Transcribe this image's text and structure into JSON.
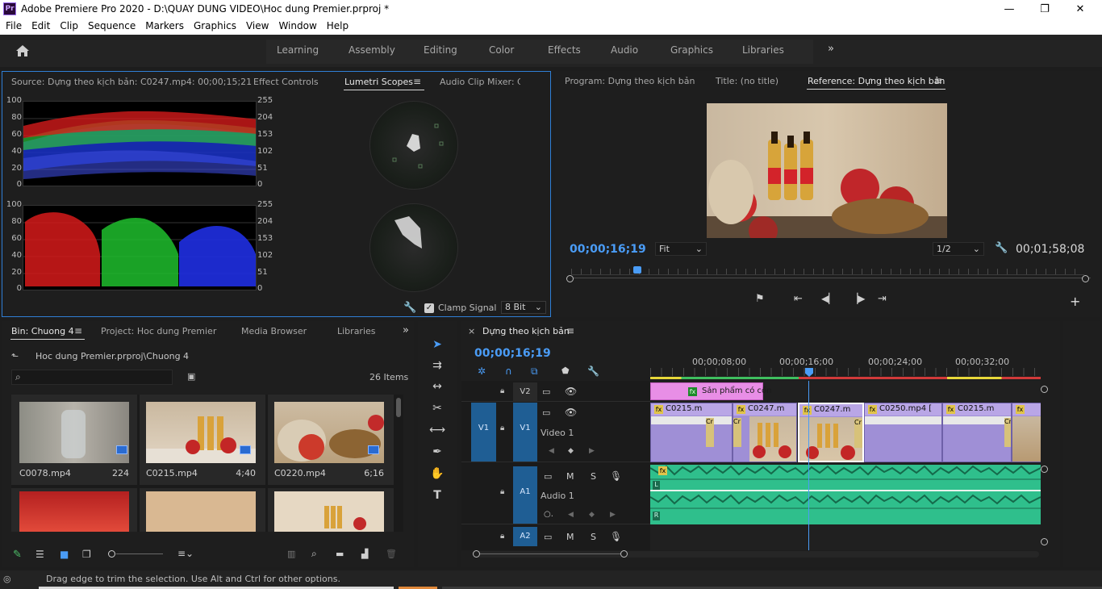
{
  "titlebar": {
    "app_title": "Adobe Premiere Pro 2020 - D:\\QUAY DUNG VIDEO\\Hoc dung Premier.prproj *",
    "logo": "Pr",
    "minimize": "—",
    "restore": "❐",
    "close": "✕"
  },
  "menu": [
    "File",
    "Edit",
    "Clip",
    "Sequence",
    "Markers",
    "Graphics",
    "View",
    "Window",
    "Help"
  ],
  "workspaces": [
    "Learning",
    "Assembly",
    "Editing",
    "Color",
    "Effects",
    "Audio",
    "Graphics",
    "Libraries"
  ],
  "source_panel": {
    "tabs": [
      "Source: Dựng theo kịch bản: C0247.mp4: 00;00;15;21",
      "Effect Controls",
      "Lumetri Scopes",
      "Audio Clip Mixer: C("
    ],
    "scale_left": [
      "100",
      "80",
      "60",
      "40",
      "20",
      "0"
    ],
    "scale_right": [
      "255",
      "204",
      "153",
      "102",
      "51",
      "0"
    ],
    "clamp_label": "Clamp Signal",
    "bit_depth": "8 Bit"
  },
  "program_panel": {
    "tabs": [
      "Program: Dựng theo kịch bản",
      "Title: (no title)",
      "Reference: Dựng theo kịch bản"
    ],
    "timecode": "00;00;16;19",
    "fit": "Fit",
    "resolution": "1/2",
    "duration": "00;01;58;08"
  },
  "project_panel": {
    "tabs": [
      "Bin: Chuong 4",
      "Project: Hoc dung Premier",
      "Media Browser",
      "Libraries"
    ],
    "path": "Hoc dung Premier.prproj\\Chuong 4",
    "items_count": "26 Items",
    "items": [
      {
        "name": "C0078.mp4",
        "duration": "224"
      },
      {
        "name": "C0215.mp4",
        "duration": "4;40"
      },
      {
        "name": "C0220.mp4",
        "duration": "6;16"
      }
    ]
  },
  "timeline": {
    "tab": "Dựng theo kịch bản",
    "timecode": "00;00;16;19",
    "ruler": [
      "00;00;08;00",
      "00;00;16;00",
      "00;00;24;00",
      "00;00;32;00"
    ],
    "tracks": {
      "v2": "V2",
      "v1_src": "V1",
      "v1": "V1",
      "video1_name": "Video 1",
      "a1": "A1",
      "audio1_name": "Audio 1",
      "a2": "A2",
      "m": "M",
      "s": "S"
    },
    "title_clip": "Sản phẩm có cồn",
    "video_clips": [
      "C0215.m",
      "C0247.m",
      "C0247.m",
      "C0250.mp4 [",
      "C0215.m"
    ],
    "cr": "Cr",
    "audio_l": "L",
    "audio_r": "R",
    "fx": "fx"
  },
  "status": {
    "message": "Drag edge to trim the selection. Use Alt and Ctrl for other options."
  },
  "colors": {
    "accent": "#4a9cf6",
    "clip_video": "#9f8fd6",
    "clip_audio": "#2fbf8c",
    "clip_title": "#e88ee6",
    "track_blue": "#1f5e94"
  }
}
